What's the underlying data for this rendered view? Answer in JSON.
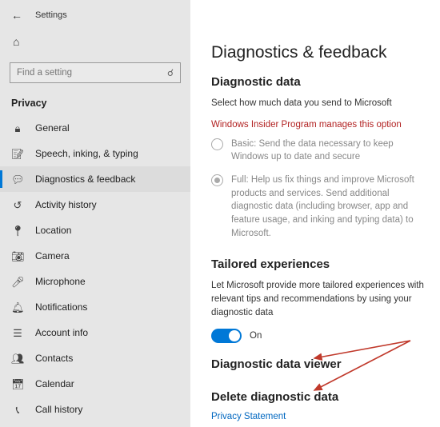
{
  "header": {
    "title": "Settings"
  },
  "search": {
    "placeholder": "Find a setting"
  },
  "section_label": "Privacy",
  "sidebar": {
    "items": [
      {
        "icon": "lock-icon",
        "label": "General"
      },
      {
        "icon": "speech-icon",
        "label": "Speech, inking, & typing"
      },
      {
        "icon": "feedback-icon",
        "label": "Diagnostics & feedback",
        "active": true
      },
      {
        "icon": "history-icon",
        "label": "Activity history"
      },
      {
        "icon": "location-icon",
        "label": "Location"
      },
      {
        "icon": "camera-icon",
        "label": "Camera"
      },
      {
        "icon": "microphone-icon",
        "label": "Microphone"
      },
      {
        "icon": "notifications-icon",
        "label": "Notifications"
      },
      {
        "icon": "account-icon",
        "label": "Account info"
      },
      {
        "icon": "contacts-icon",
        "label": "Contacts"
      },
      {
        "icon": "calendar-icon",
        "label": "Calendar"
      },
      {
        "icon": "call-icon",
        "label": "Call history"
      }
    ]
  },
  "main": {
    "page_title": "Diagnostics & feedback",
    "diag_heading": "Diagnostic data",
    "diag_desc": "Select how much data you send to Microsoft",
    "insider_note": "Windows Insider Program manages this option",
    "radio_basic": "Basic: Send the data necessary to keep Windows up to date and secure",
    "radio_full": "Full: Help us fix things and improve Microsoft products and services. Send additional diagnostic data (including browser, app and feature usage, and inking and typing data) to Microsoft.",
    "tailored_heading": "Tailored experiences",
    "tailored_desc": "Let Microsoft provide more tailored experiences with relevant tips and recommendations by using your diagnostic data",
    "toggle_state": "On",
    "viewer_heading": "Diagnostic data viewer",
    "delete_heading": "Delete diagnostic data",
    "privacy_link": "Privacy Statement"
  }
}
